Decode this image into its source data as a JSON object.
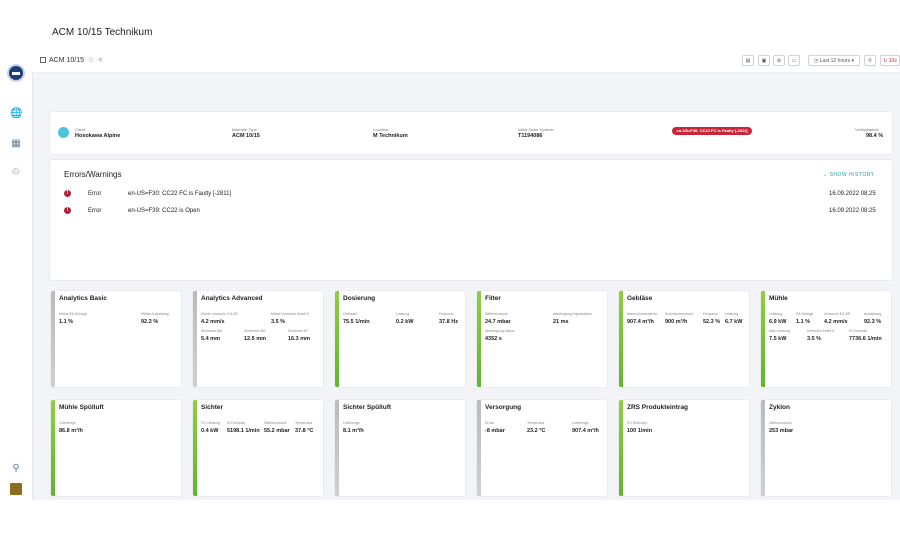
{
  "header": {
    "breadcrumb": "ACM 10/15",
    "page_title": "ACM 10/15 Technikum",
    "time_range": "Last 12 hours",
    "refresh": "10s"
  },
  "info": [
    {
      "label": "Client",
      "value": "Hosokawa Alpine"
    },
    {
      "label": "Machine Type",
      "value": "ACM 10/15"
    },
    {
      "label": "Location",
      "value": "M Technikum"
    },
    {
      "label": "Initial Order Number",
      "value": "T1194086"
    },
    {
      "label": "Verfügbarkeit",
      "value": "98.4 %"
    }
  ],
  "alarm_badge": "en-US=F30: CC22 FC is Faulty [-2811]",
  "errors": {
    "title": "Errors/Warnings",
    "show_history": "SHOW HISTORY",
    "items": [
      {
        "severity": "Error",
        "message": "en-US=F30: CC22 FC is Faulty [-2811]",
        "time": "16.09.2022 08:25"
      },
      {
        "severity": "Error",
        "message": "en-US=F39: CC22 is Open",
        "time": "16.09.2022 08:25"
      }
    ]
  },
  "cards": [
    {
      "title": "Analytics Basic",
      "metrics": [
        {
          "label": "Mühle EA Schlagt",
          "value": "1.1 %"
        },
        {
          "label": "Mühle Auslastung",
          "value": "92.3 %"
        }
      ]
    },
    {
      "title": "Analytics Advanced",
      "metrics": [
        {
          "label": "Mühle Umwuchr EA-SR",
          "value": "4.2 mm/s"
        },
        {
          "label": "Mühle Umwuchr Anteil S",
          "value": "3.5 %"
        },
        {
          "label": "Sichtrotor AM",
          "value": "5.4 mm"
        },
        {
          "label": "Sichtrotor WS",
          "value": "12.5 mm"
        },
        {
          "label": "Sichtrotor AT",
          "value": "16.3 mm"
        }
      ]
    },
    {
      "title": "Dosierung",
      "metrics": [
        {
          "label": "Drehzahl",
          "value": "75.5 1/min"
        },
        {
          "label": "Leistung",
          "value": "0.2 kW"
        },
        {
          "label": "Frequenz",
          "value": "37.8 Hz"
        }
      ]
    },
    {
      "title": "Filter",
      "metrics": [
        {
          "label": "Differenzdruck",
          "value": "24.7 mbar"
        },
        {
          "label": "Abreinigung Impulsdauer",
          "value": "21 ms"
        },
        {
          "label": "Abreinigung Zyklus",
          "value": "4352 s"
        }
      ]
    },
    {
      "title": "Gebläse",
      "metrics": [
        {
          "label": "Nennvolumenstrom",
          "value": "907.4 m³/h"
        },
        {
          "label": "Sollvolumenstrom",
          "value": "900 m³/h"
        },
        {
          "label": "Frequenz",
          "value": "52.3 %"
        },
        {
          "label": "Leistung",
          "value": "6.7 kW"
        }
      ]
    },
    {
      "title": "Mühle",
      "metrics": [
        {
          "label": "Leistung",
          "value": "6.9 kW"
        },
        {
          "label": "EA Schlagt",
          "value": "1.1 %"
        },
        {
          "label": "Umwuchr EA-SR",
          "value": "4.2 mm/s"
        },
        {
          "label": "Auslastung",
          "value": "92.3 %"
        },
        {
          "label": "Max Leistung",
          "value": "7.5 kW"
        },
        {
          "label": "Umwuchr Anteil S",
          "value": "3.5 %"
        },
        {
          "label": "IS Drehzahl",
          "value": "7736.6 1/min"
        }
      ]
    },
    {
      "title": "Mühle Spülluft",
      "metrics": [
        {
          "label": "Luftmenge",
          "value": "86.8 m³/h"
        }
      ]
    },
    {
      "title": "Sichter",
      "metrics": [
        {
          "label": "FU Leistung",
          "value": "0.4 kW"
        },
        {
          "label": "IS Drehzahl",
          "value": "5198.1 1/min"
        },
        {
          "label": "Differenzdruck",
          "value": "55.2 mbar"
        },
        {
          "label": "Temperatur",
          "value": "37.8 °C"
        }
      ]
    },
    {
      "title": "Sichter Spülluft",
      "metrics": [
        {
          "label": "Luftmenge",
          "value": "8.1 m³/h"
        }
      ]
    },
    {
      "title": "Versorgung",
      "metrics": [
        {
          "label": "Druck",
          "value": "-8 mbar"
        },
        {
          "label": "Temperatur",
          "value": "23.2 °C"
        },
        {
          "label": "Luftmenge",
          "value": "907.4 m³/h"
        }
      ]
    },
    {
      "title": "ZRS Produkteintrag",
      "metrics": [
        {
          "label": "FU Drehzahl",
          "value": "100 1/min"
        }
      ]
    },
    {
      "title": "Zyklon",
      "metrics": [
        {
          "label": "Differenzdruck",
          "value": "253 mbar"
        }
      ]
    }
  ]
}
